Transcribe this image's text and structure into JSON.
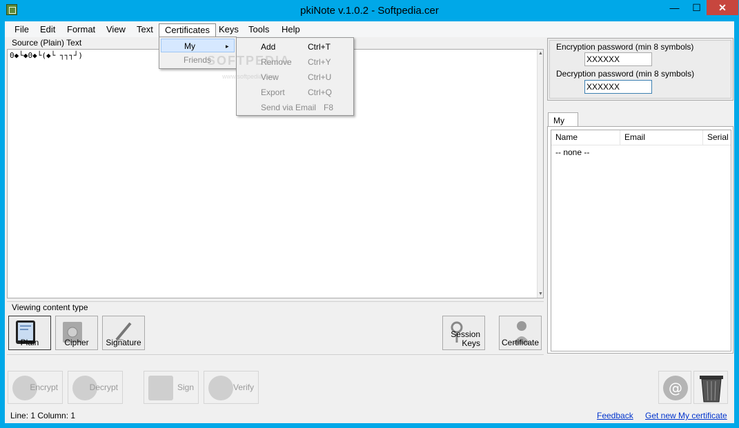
{
  "window": {
    "title": "pkiNote  v.1.0.2 - Softpedia.cer",
    "minimize": "—",
    "maximize": "☐",
    "close": "✕"
  },
  "menubar": [
    "File",
    "Edit",
    "Format",
    "View",
    "Text",
    "Certificates",
    "Keys",
    "Tools",
    "Help"
  ],
  "certificates_menu": {
    "items": [
      {
        "label": "My",
        "arrow": "▸"
      },
      {
        "label": "Friends"
      }
    ]
  },
  "my_submenu": {
    "items": [
      {
        "label": "Add",
        "shortcut": "Ctrl+T"
      },
      {
        "label": "Remove",
        "shortcut": "Ctrl+Y"
      },
      {
        "label": "View",
        "shortcut": "Ctrl+U"
      },
      {
        "label": "Export",
        "shortcut": "Ctrl+Q"
      },
      {
        "label": "Send via Email",
        "shortcut": "F8"
      }
    ]
  },
  "source": {
    "label": "Source (Plain) Text",
    "content": "0◆└◆0◆└(◆└   ┐┐┐┘)"
  },
  "viewing": {
    "label": "Viewing content type",
    "buttons": [
      "Plain",
      "Cipher",
      "Signature"
    ],
    "right_buttons": [
      "Session Keys",
      "Certificate"
    ]
  },
  "actions": [
    "Encrypt",
    "Decrypt",
    "Sign",
    "Verify"
  ],
  "passwords": {
    "encryption_label": "Encryption password (min 8 symbols)",
    "encryption_value": "XXXXXX",
    "decryption_label": "Decryption password (min 8 symbols)",
    "decryption_value": "XXXXXX"
  },
  "certs": {
    "tab": "My",
    "columns": [
      "Name",
      "Email",
      "Serial N"
    ],
    "rows": [
      "-- none --"
    ]
  },
  "status": {
    "line": "Line: 1  Column: 1",
    "feedback": "Feedback",
    "get_cert": "Get new My certificate"
  },
  "watermark": {
    "text": "SOFTPEDIA",
    "url": "www.softpedia.com"
  }
}
